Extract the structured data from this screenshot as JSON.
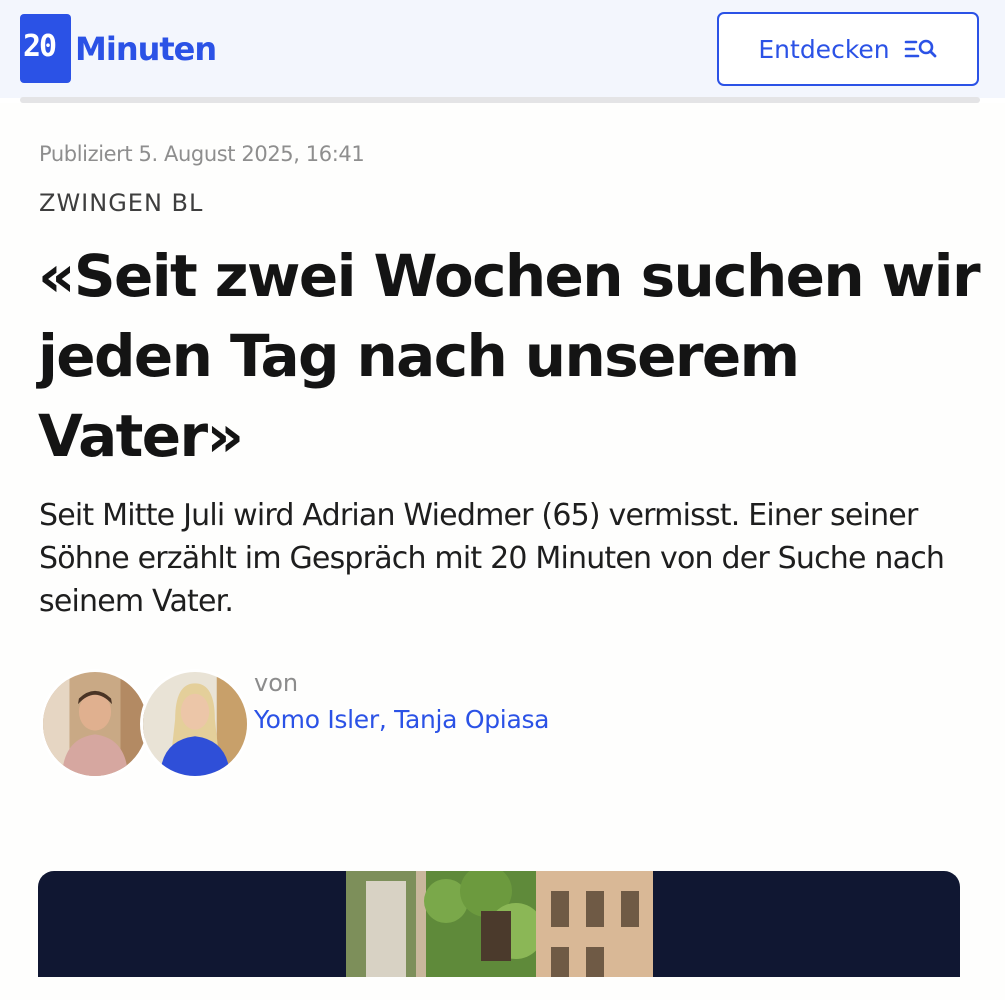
{
  "header": {
    "logo": {
      "mark_text": "20",
      "wordmark": "Minuten"
    },
    "discover_button": {
      "label": "Entdecken",
      "icon": "search-list-icon"
    }
  },
  "article": {
    "published": "Publiziert 5. August 2025, 16:41",
    "kicker": "ZWINGEN BL",
    "headline": "«Seit zwei Wochen suchen wir jeden Tag nach unserem Vater»",
    "lead": "Seit Mitte Juli wird Adrian Wiedmer (65) vermisst. Einer seiner Söhne erzählt im Gespräch mit 20 Minuten von der Suche nach seinem Vater.",
    "byline": {
      "prefix": "von",
      "authors": "Yomo Isler, Tanja Opiasa"
    }
  },
  "colors": {
    "brand_blue": "#2b52e6",
    "header_bg": "#f3f6fd",
    "media_bg": "#101732",
    "text": "#141414",
    "muted": "#8e8e8e"
  }
}
